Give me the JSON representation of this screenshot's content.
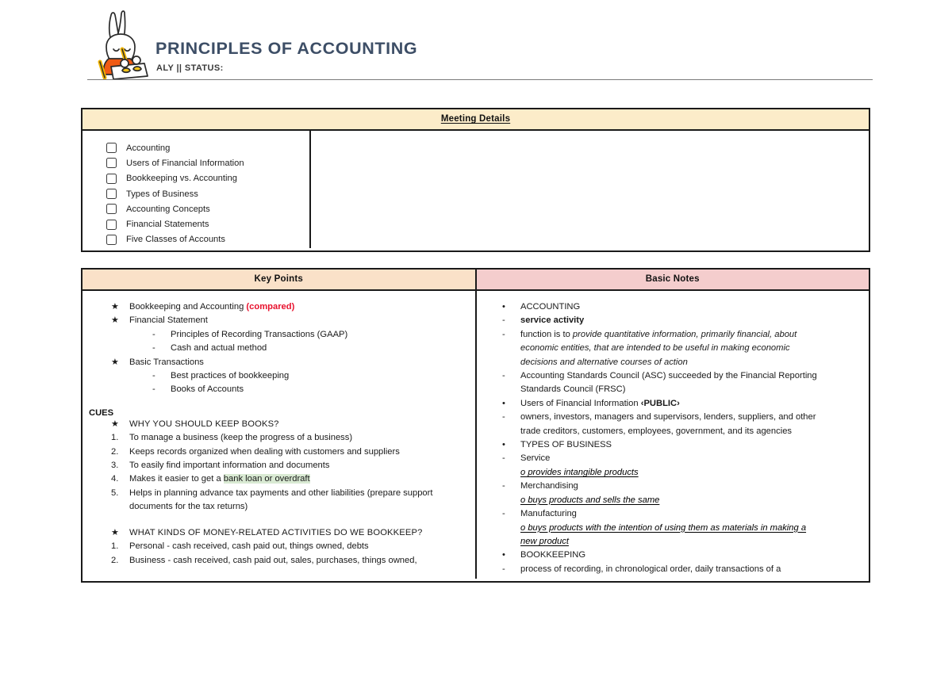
{
  "header": {
    "title": "PRINCIPLES OF ACCOUNTING",
    "subtitle": "ALY || STATUS:",
    "mascot_icon": "rabbit-writing-icon",
    "title_color": "#3d4e66"
  },
  "meeting": {
    "header_label": "Meeting Details",
    "checklist": [
      "Accounting",
      "Users of Financial Information",
      "Bookkeeping vs. Accounting",
      "Types of Business",
      "Accounting Concepts",
      "Financial Statements",
      "Five Classes of Accounts"
    ],
    "notes_area_value": ""
  },
  "notes": {
    "key_points_header": "Key Points",
    "basic_notes_header": "Basic Notes",
    "key_points": {
      "top_items": [
        {
          "mark": "★",
          "text": "Bookkeeping and Accounting ",
          "emphasis": "(compared)",
          "level": 1
        },
        {
          "mark": "★",
          "text": "Financial Statement",
          "level": 1
        },
        {
          "mark": "-",
          "text": "Principles of Recording Transactions (GAAP)",
          "level": 2
        },
        {
          "mark": "-",
          "text": "Cash and actual method",
          "level": 2
        },
        {
          "mark": "★",
          "text": "Basic Transactions",
          "level": 1
        },
        {
          "mark": "-",
          "text": "Best practices of bookkeeping",
          "level": 2
        },
        {
          "mark": "-",
          "text": "Books of Accounts",
          "level": 2
        }
      ],
      "cues_label": "CUES",
      "cues_question_1": {
        "mark": "★",
        "text": "WHY YOU SHOULD KEEP BOOKS?"
      },
      "cues_list_1": [
        {
          "num": "1.",
          "text": "To manage a business (keep the progress of a business)"
        },
        {
          "num": "2.",
          "text": "Keeps records organized when dealing with customers and suppliers"
        },
        {
          "num": "3.",
          "text": "To easily find important information and documents"
        },
        {
          "num": "4.",
          "pre": "Makes it easier to get a ",
          "highlight": "bank loan or overdraft"
        },
        {
          "num": "5.",
          "text": "Helps in planning advance tax payments and other liabilities (prepare support documents for the tax returns)"
        }
      ],
      "cues_question_2": {
        "mark": "★",
        "text": "WHAT KINDS OF MONEY-RELATED ACTIVITIES DO WE BOOKKEEP?"
      },
      "cues_list_2": [
        {
          "num": "1.",
          "text": "Personal - cash received, cash paid out, things owned, debts"
        },
        {
          "num": "2.",
          "text": "Business - cash received, cash paid out, sales, purchases, things owned,"
        }
      ]
    },
    "basic_notes": [
      {
        "mark": "•",
        "text": "ACCOUNTING"
      },
      {
        "mark": "-",
        "text": "service activity",
        "style": "bold"
      },
      {
        "mark": "-",
        "pre": "function is to ",
        "text": "provide quantitative information, primarily financial, about",
        "style": "italic",
        "continuation": [
          "economic entities, that are intended to be useful in making economic",
          "decisions and alternative courses of action"
        ]
      },
      {
        "mark": "-",
        "text": "Accounting Standards Council (ASC) succeeded by the Financial Reporting",
        "continuation": [
          "Standards Council (FRSC)"
        ]
      },
      {
        "mark": "•",
        "pre": "Users of Financial Information ",
        "emphasis": "‹PUBLIC›"
      },
      {
        "mark": "-",
        "text": "owners, investors, managers and supervisors, lenders, suppliers, and other",
        "continuation": [
          "trade creditors, customers, employees, government, and its agencies"
        ]
      },
      {
        "mark": "•",
        "text": "TYPES OF BUSINESS"
      },
      {
        "mark": "-",
        "text": "Service",
        "sub": [
          "o  provides intangible products"
        ]
      },
      {
        "mark": "-",
        "text": "Merchandising",
        "sub": [
          "o  buys products and sells the same"
        ]
      },
      {
        "mark": "-",
        "text": "Manufacturing",
        "sub": [
          "o   buys products with the intention of using them as materials in making a",
          "new product"
        ]
      },
      {
        "mark": "•",
        "text": "BOOKKEEPING"
      },
      {
        "mark": "-",
        "text": "process of recording, in chronological order, daily transactions of a"
      }
    ]
  },
  "colors": {
    "meeting_header_bg": "#fcecc9",
    "key_points_header_bg": "#fae1c8",
    "basic_notes_header_bg": "#f4cdcd",
    "highlight_green": "#d9ead3",
    "accent_red": "#e8112d",
    "border": "#1a1a1a"
  }
}
